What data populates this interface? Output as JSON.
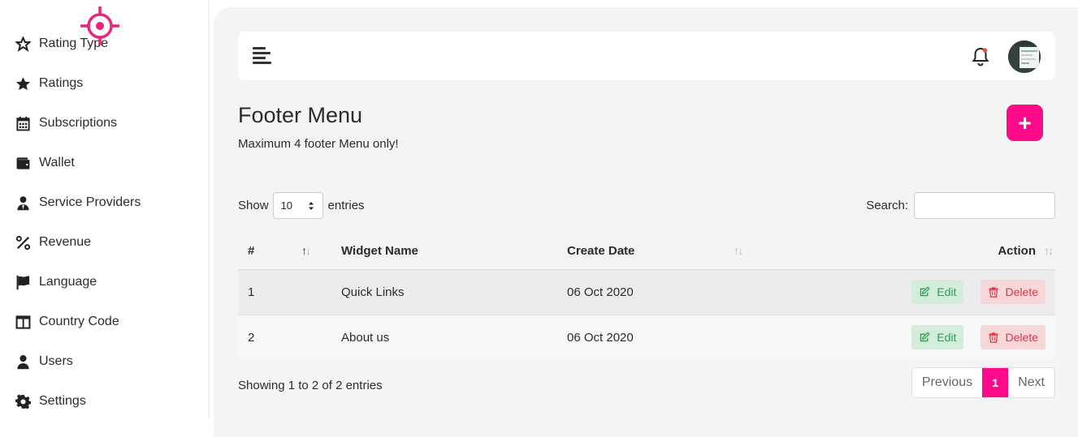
{
  "sidebar": {
    "items": [
      {
        "label": "Rating Type",
        "icon": "star-outline-icon"
      },
      {
        "label": "Ratings",
        "icon": "star-icon"
      },
      {
        "label": "Subscriptions",
        "icon": "calendar-icon"
      },
      {
        "label": "Wallet",
        "icon": "wallet-icon"
      },
      {
        "label": "Service Providers",
        "icon": "user-tie-icon"
      },
      {
        "label": "Revenue",
        "icon": "percent-icon"
      },
      {
        "label": "Language",
        "icon": "flag-icon"
      },
      {
        "label": "Country Code",
        "icon": "columns-icon"
      },
      {
        "label": "Users",
        "icon": "user-icon"
      },
      {
        "label": "Settings",
        "icon": "gear-icon"
      }
    ]
  },
  "page": {
    "title": "Footer Menu",
    "subtitle": "Maximum 4 footer Menu only!",
    "add_label": "+"
  },
  "table_controls": {
    "show_label": "Show",
    "entries_label": "entries",
    "page_length": "10",
    "search_label": "Search:",
    "search_value": ""
  },
  "table": {
    "columns": [
      "#",
      "Widget Name",
      "Create Date",
      "Action"
    ],
    "rows": [
      {
        "num": "1",
        "name": "Quick Links",
        "date": "06 Oct 2020"
      },
      {
        "num": "2",
        "name": "About us",
        "date": "06 Oct 2020"
      }
    ],
    "edit_label": "Edit",
    "delete_label": "Delete"
  },
  "footer": {
    "info": "Showing 1 to 2 of 2 entries",
    "prev_label": "Previous",
    "current_page": "1",
    "next_label": "Next"
  },
  "colors": {
    "accent": "#fe0a8b",
    "edit_text": "#2e9e52",
    "delete_text": "#dc3545"
  }
}
